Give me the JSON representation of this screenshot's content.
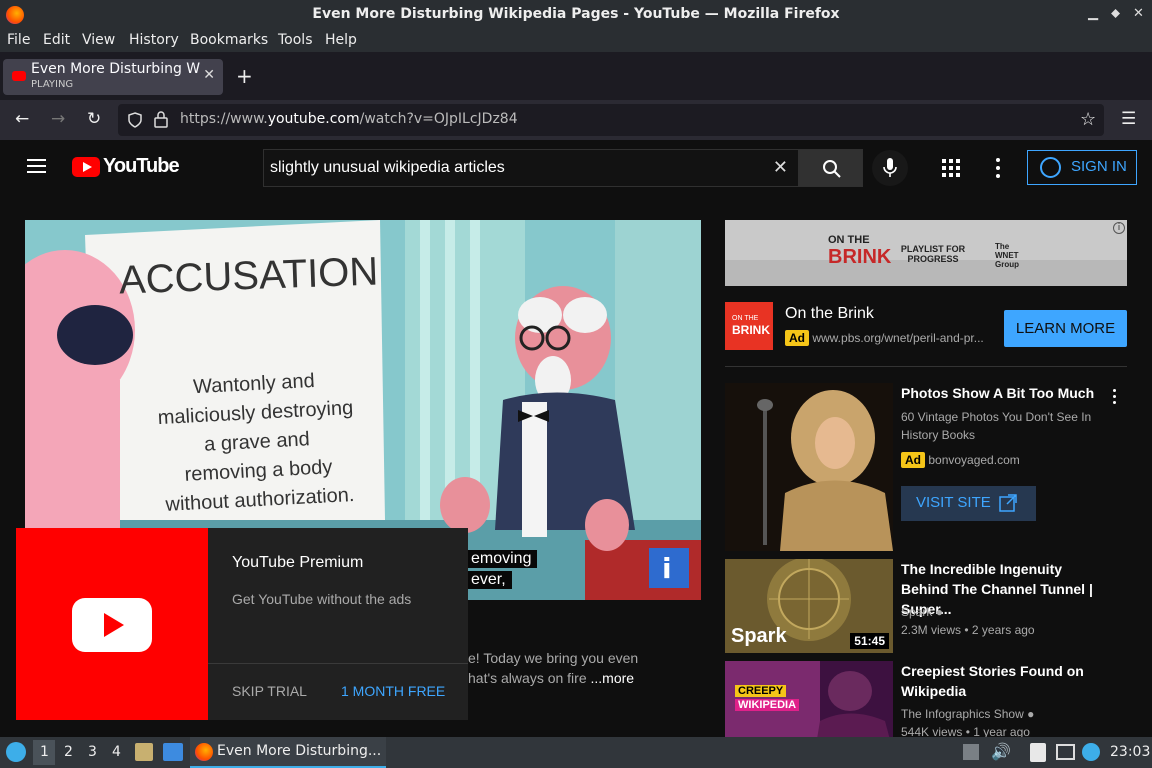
{
  "window": {
    "title": "Even More Disturbing Wikipedia Pages - YouTube — Mozilla Firefox"
  },
  "menu": [
    "File",
    "Edit",
    "View",
    "History",
    "Bookmarks",
    "Tools",
    "Help"
  ],
  "tab": {
    "title": "Even More Disturbing Wi",
    "status": "PLAYING",
    "close": "✕",
    "new": "+"
  },
  "nav": {
    "url_prefix": "https://www.",
    "url_domain": "youtube.com",
    "url_rest": "/watch?v=OJpILcJDz84"
  },
  "yt": {
    "brand": "YouTube",
    "search_value": "slightly unusual wikipedia articles",
    "signin": "SIGN IN"
  },
  "video": {
    "sign_title": "ACCUSATION",
    "sign_lines": [
      "Wantonly and",
      "maliciously destroying",
      "a grave and",
      "removing a body",
      "without authorization."
    ],
    "caption_1": "emoving",
    "caption_2": "ever,",
    "corner_logo": "i"
  },
  "premium": {
    "title": "YouTube Premium",
    "subtitle": "Get YouTube without the ads",
    "skip": "SKIP TRIAL",
    "free": "1 MONTH FREE"
  },
  "description": {
    "line1": "e! Today we bring you even",
    "line2": "hat's always on fire",
    "more": "...more"
  },
  "ad_banner": {
    "left": "ON THE",
    "left2": "BRINK",
    "mid": "PLAYLIST FOR PROGRESS",
    "right": "The WNET Group",
    "info": "i"
  },
  "ad": {
    "logo_top": "ON THE",
    "logo_bottom": "BRINK",
    "title": "On the Brink",
    "badge": "Ad",
    "url": "www.pbs.org/wnet/peril-and-pr...",
    "button": "LEARN MORE"
  },
  "sidebar": [
    {
      "title": "Photos Show A Bit Too Much",
      "line1": "60 Vintage Photos You Don't See In",
      "line2": "History Books",
      "badge": "Ad",
      "domain": "bonvoyaged.com",
      "button": "VISIT SITE"
    },
    {
      "title": "The Incredible Ingenuity Behind The Channel Tunnel | Super...",
      "channel": "Spark",
      "meta": "2.3M views • 2 years ago",
      "thumb_text": "Spark",
      "duration": "51:45"
    },
    {
      "title": "Creepiest Stories Found on Wikipedia",
      "channel": "The Infographics Show",
      "meta": "544K views • 1 year ago",
      "thumb_top": "CREEPY",
      "thumb_bottom": "WIKIPEDIA"
    }
  ],
  "taskbar": {
    "desktops": [
      "1",
      "2",
      "3",
      "4"
    ],
    "task": "Even More Disturbing...",
    "clock": "23:03"
  }
}
